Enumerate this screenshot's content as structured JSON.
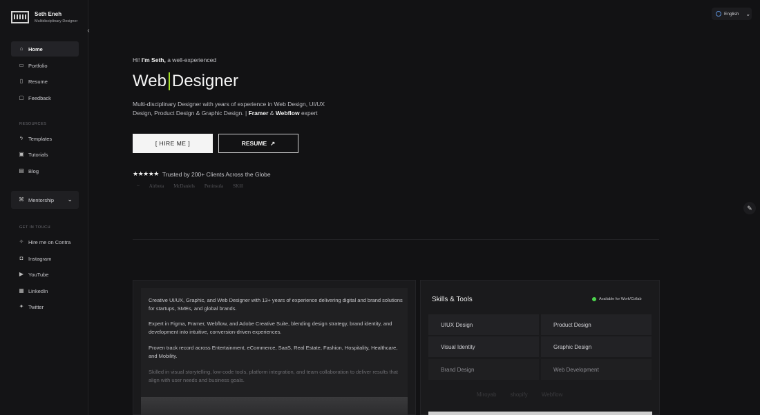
{
  "brand": {
    "name": "Seth Eneh",
    "subtitle": "Multidisciplinary Designer"
  },
  "sidebar": {
    "nav": [
      {
        "label": "Home",
        "icon": "home-icon",
        "active": true
      },
      {
        "label": "Portfolio",
        "icon": "laptop-icon"
      },
      {
        "label": "Resume",
        "icon": "document-icon"
      },
      {
        "label": "Feedback",
        "icon": "chat-icon"
      }
    ],
    "resources_label": "RESOURCES",
    "resources": [
      {
        "label": "Templates",
        "icon": "bolt-icon"
      },
      {
        "label": "Tutorials",
        "icon": "video-icon"
      },
      {
        "label": "Blog",
        "icon": "blog-icon"
      }
    ],
    "mentorship_label": "Mentorship",
    "contact_label": "GET IN TOUCH",
    "contact": [
      {
        "label": "Hire me on Contra",
        "icon": "contra-icon"
      },
      {
        "label": "Instagram",
        "icon": "instagram-icon"
      },
      {
        "label": "YouTube",
        "icon": "youtube-icon"
      },
      {
        "label": "LinkedIn",
        "icon": "linkedin-icon"
      },
      {
        "label": "Twitter",
        "icon": "twitter-icon"
      }
    ]
  },
  "language": {
    "selected": "English"
  },
  "hero": {
    "greeting_prefix": "Hi! ",
    "greeting_name": "I'm Seth,",
    "greeting_suffix": " a well-experienced",
    "title_a": "Web",
    "title_b": "Designer",
    "desc_main": "Multi-disciplinary Designer with years of experience in Web Design, UI/UX Design, Product Design & Graphic Design.  |  ",
    "desc_framer": "Framer",
    "desc_amp": " & ",
    "desc_webflow": "Webflow",
    "desc_end": " expert",
    "hire_label": "[ HIRE ME ]",
    "resume_label": "RESUME",
    "trust_text": "Trusted by 200+ Clients Across the Globe",
    "stars": "★★★★★",
    "clients": [
      "~",
      "Airbota",
      "McDaniels",
      "Peninsula",
      "SKill"
    ]
  },
  "about": [
    "Creative UI/UX, Graphic, and Web Designer with 13+ years of experience delivering digital and brand solutions for startups, SMEs, and global brands.",
    "Expert in Figma, Framer, Webflow, and Adobe Creative Suite, blending design strategy, brand identity, and development into intuitive, conversion-driven experiences.",
    "Proven track record across Entertainment, eCommerce, SaaS, Real Estate, Fashion, Hospitality, Healthcare, and Mobility.",
    "Skilled in visual storytelling, low-code tools, platform integration, and team collaboration to deliver results that align with user needs and business goals."
  ],
  "skills": {
    "title": "Skills & Tools",
    "availability": "Available for Work/Collab",
    "status_color": "#4cd34c",
    "items": [
      "UIUX Design",
      "Product Design",
      "Visual Identity",
      "Graphic Design",
      "Brand Design",
      "Web Development"
    ],
    "tools": [
      "Miroyab",
      "shopify",
      "Webflow"
    ]
  },
  "accent_color": "#a7e02b"
}
